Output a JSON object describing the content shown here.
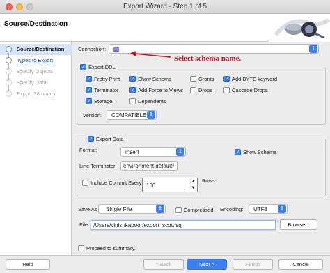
{
  "window": {
    "title": "Export Wizard - Step 1 of 5"
  },
  "header": {
    "title": "Source/Destination"
  },
  "nav": {
    "items": [
      {
        "label": "Source/Destination"
      },
      {
        "label": "Types to Export"
      },
      {
        "label": "Specify Objects"
      },
      {
        "label": "Specify Data"
      },
      {
        "label": "Export Summary"
      }
    ]
  },
  "connection": {
    "label": "Connection:",
    "value": ""
  },
  "annotation": {
    "text": "Select schema name."
  },
  "ddl": {
    "label": "Export DDL",
    "options": [
      {
        "label": "Pretty Print",
        "checked": true
      },
      {
        "label": "Show Schema",
        "checked": true
      },
      {
        "label": "Grants",
        "checked": false
      },
      {
        "label": "Add BYTE keyword",
        "checked": true
      },
      {
        "label": "Terminator",
        "checked": true
      },
      {
        "label": "Add Force to Views",
        "checked": true
      },
      {
        "label": "Drops",
        "checked": false
      },
      {
        "label": "Cascade Drops",
        "checked": false
      },
      {
        "label": "Storage",
        "checked": true
      },
      {
        "label": "Dependents",
        "checked": false
      }
    ],
    "version_label": "Version:",
    "version_value": "COMPATIBLE"
  },
  "data": {
    "label": "Export Data",
    "format_label": "Format:",
    "format_value": "insert",
    "show_schema_label": "Show Schema",
    "line_terminator_label": "Line Terminator:",
    "line_terminator_value": "environment default",
    "commit_label": "Include Commit Every",
    "commit_value": "100",
    "rows_label": "Rows"
  },
  "save": {
    "label": "Save As",
    "value": "Single File",
    "compressed_label": "Compressed",
    "encoding_label": "Encoding:",
    "encoding_value": "UTF8"
  },
  "file": {
    "label": "File:",
    "value": "/Users/vinishkapoor/export_scott.sql",
    "browse_label": "Browse..."
  },
  "proceed": {
    "label": "Proceed to summary."
  },
  "footer": {
    "help": "Help",
    "back": "< Back",
    "next": "Next >",
    "finish": "Finish",
    "cancel": "Cancel"
  },
  "colors": {
    "accent": "#3c7ff0",
    "annotation": "#c8101e"
  }
}
